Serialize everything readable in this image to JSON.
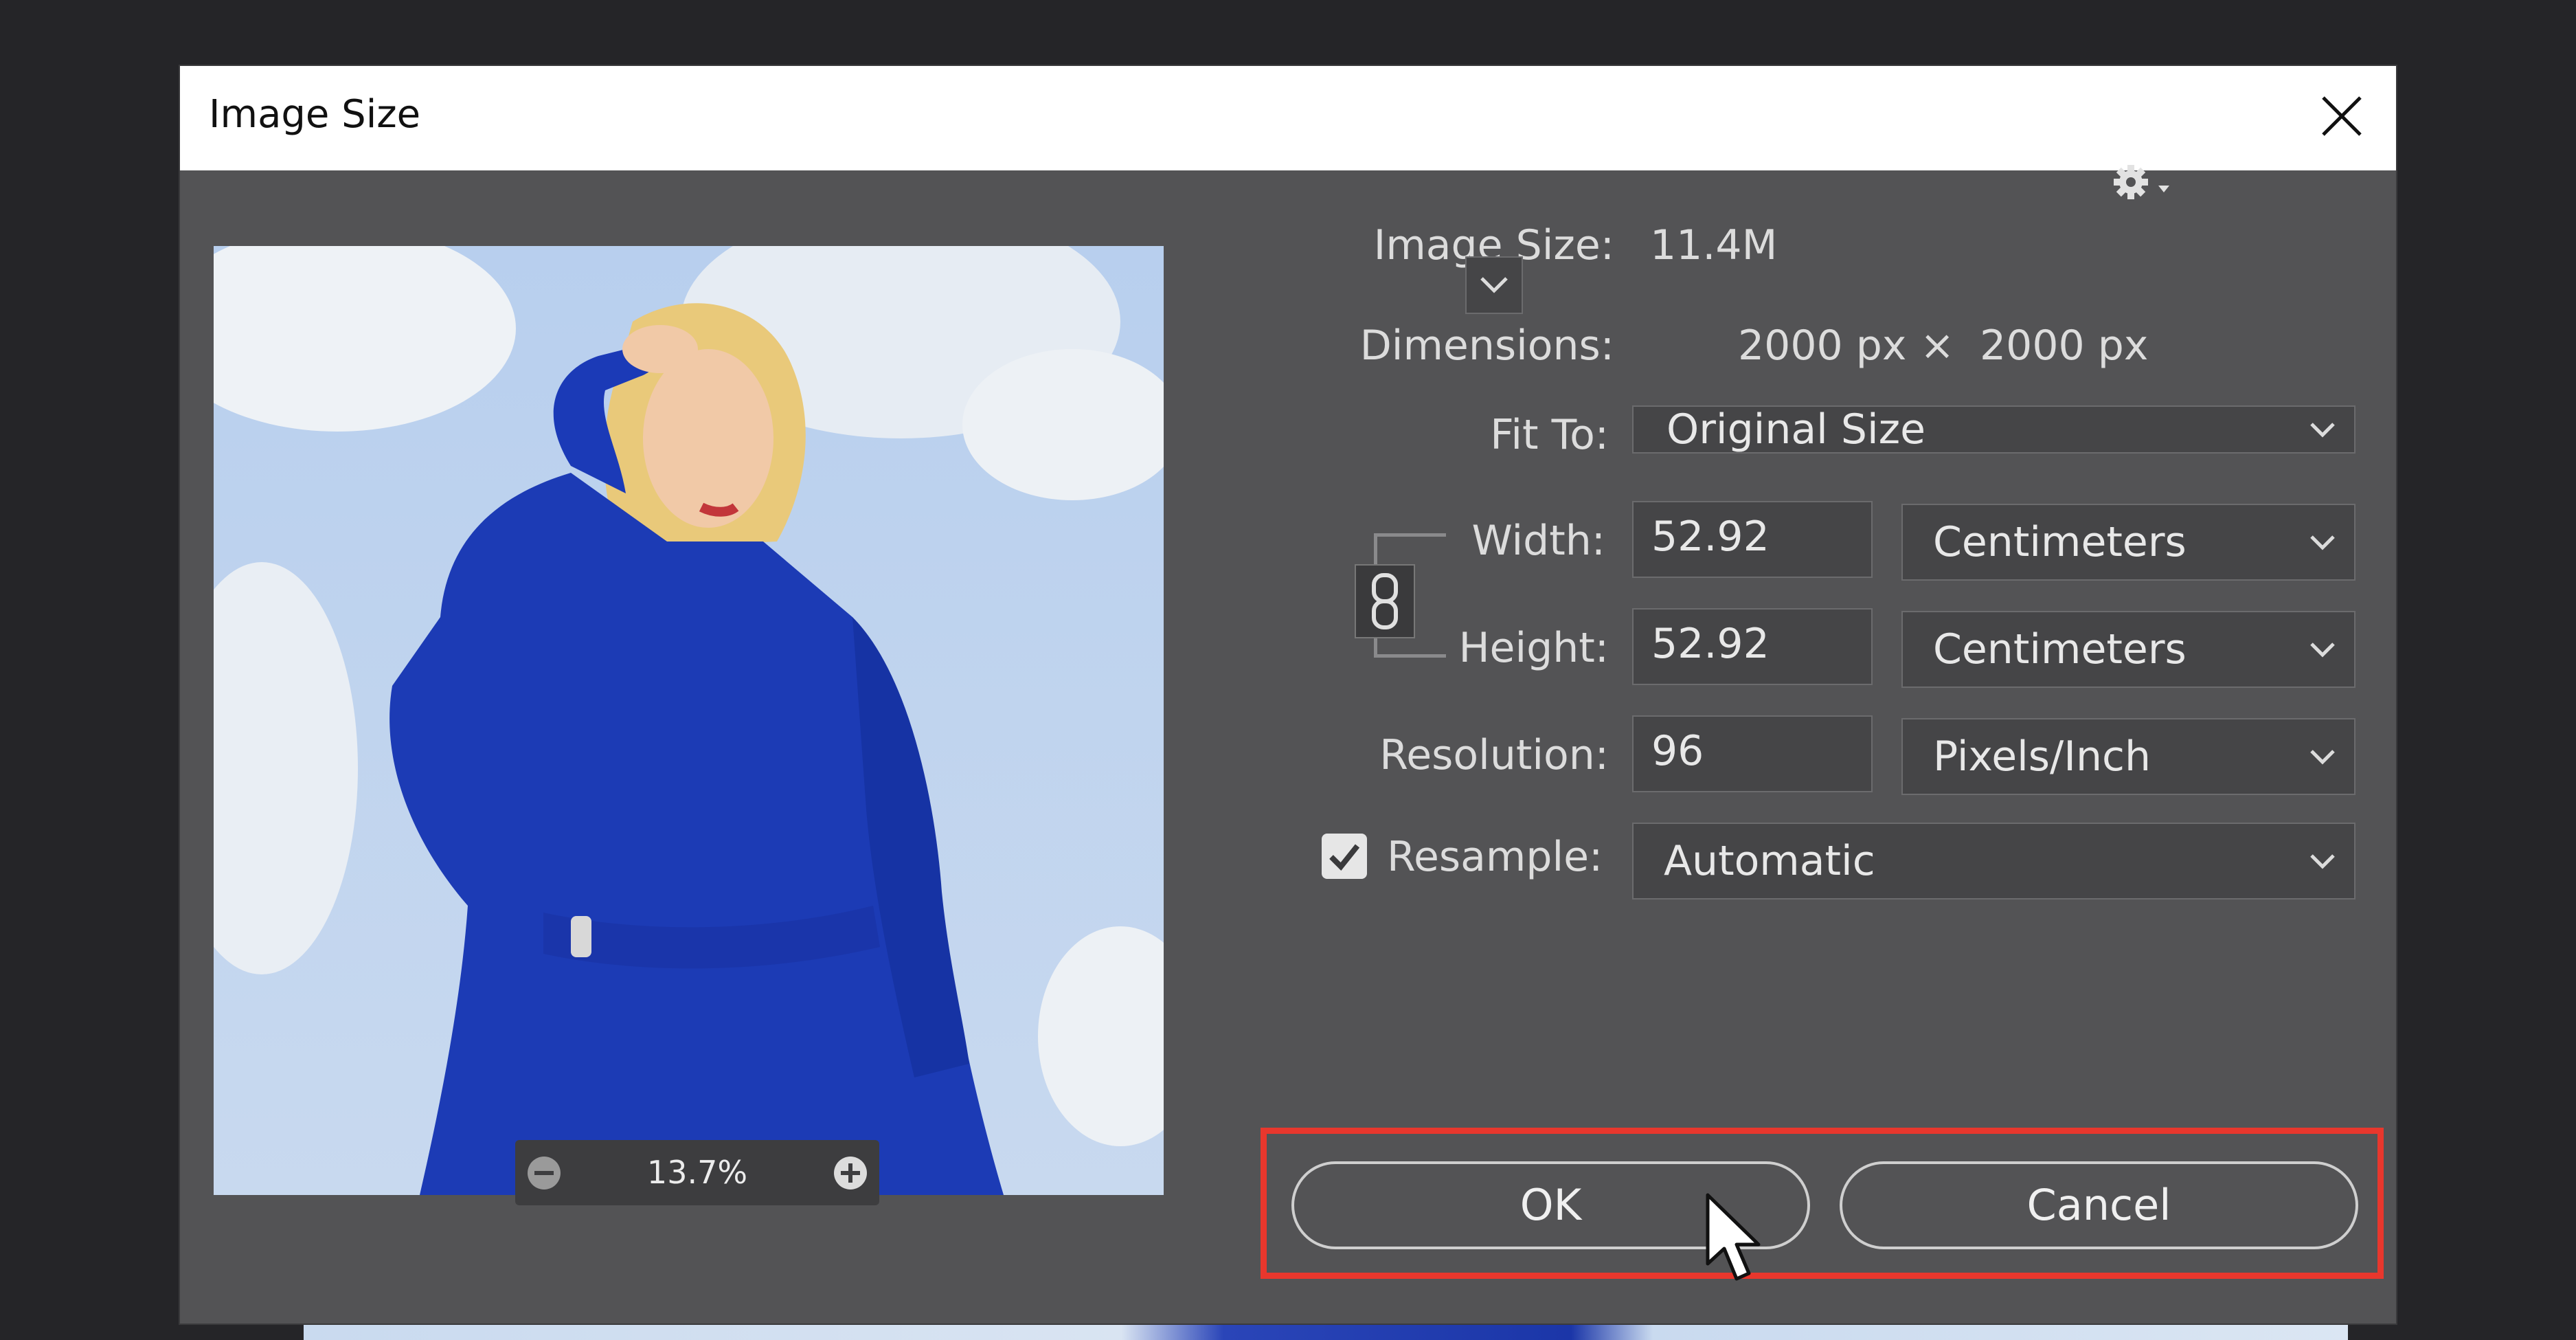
{
  "dialog": {
    "title": "Image Size"
  },
  "preview": {
    "zoom": "13.7%"
  },
  "info": {
    "image_size_label": "Image Size:",
    "image_size_value": "11.4M",
    "dimensions_label": "Dimensions:",
    "dim_width": "2000 px",
    "dim_sep": "×",
    "dim_height": "2000 px"
  },
  "fit_to": {
    "label": "Fit To:",
    "value": "Original Size"
  },
  "width": {
    "label": "Width:",
    "value": "52.92",
    "unit": "Centimeters"
  },
  "height": {
    "label": "Height:",
    "value": "52.92",
    "unit": "Centimeters"
  },
  "resolution": {
    "label": "Resolution:",
    "value": "96",
    "unit": "Pixels/Inch"
  },
  "resample": {
    "label": "Resample:",
    "checked": true,
    "value": "Automatic"
  },
  "buttons": {
    "ok": "OK",
    "cancel": "Cancel"
  },
  "colors": {
    "dialog_bg": "#535355",
    "highlight": "#e8372d"
  }
}
